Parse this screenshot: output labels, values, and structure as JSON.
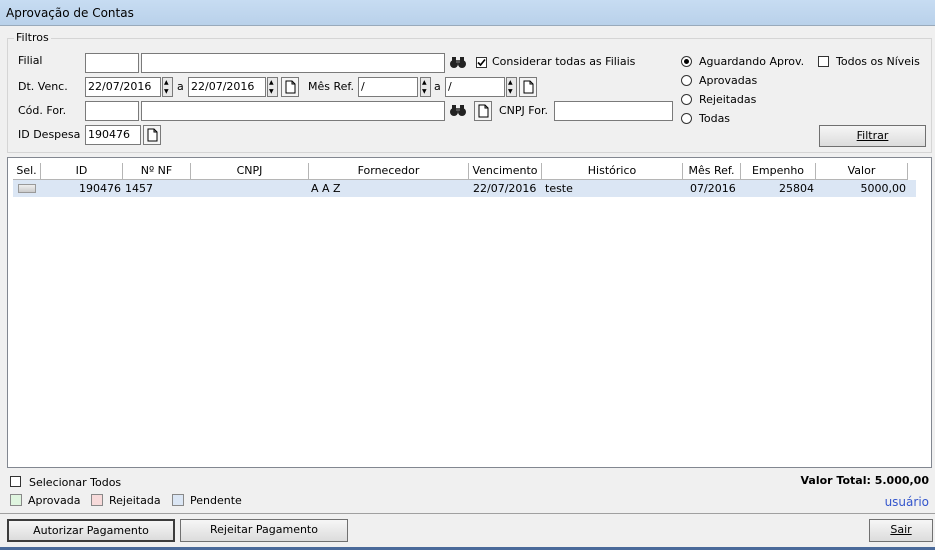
{
  "window": {
    "title": "Aprovação de Contas"
  },
  "filters": {
    "legend": "Filtros",
    "filial_label": "Filial",
    "filial_code": "",
    "filial_name": "",
    "considerar_label": "Considerar todas as Filiais",
    "dtvenc_label": "Dt. Venc.",
    "dt_from": "22/07/2016",
    "a_label": "a",
    "dt_to": "22/07/2016",
    "mesref_label": "Mês Ref.",
    "mesref_from": " /",
    "mesref_to": " /",
    "codfor_label": "Cód. For.",
    "codfor_code": "",
    "codfor_name": "",
    "cnpj_label": "CNPJ For.",
    "cnpj_value": "",
    "iddespesa_label": "ID Despesa",
    "iddespesa_value": "190476",
    "status_options": [
      "Aguardando Aprov.",
      "Aprovadas",
      "Rejeitadas",
      "Todas"
    ],
    "status_selected": "Aguardando Aprov.",
    "todos_niveis_label": "Todos os Níveis",
    "filtrar_label": "Filtrar"
  },
  "table": {
    "columns": [
      "Sel.",
      "ID",
      "Nº NF",
      "CNPJ",
      "Fornecedor",
      "Vencimento",
      "Histórico",
      "Mês Ref.",
      "Empenho",
      "Valor"
    ],
    "rows": [
      {
        "id": "190476",
        "nf": "1457",
        "cnpj": "",
        "fornecedor": "A A Z",
        "vencimento": "22/07/2016",
        "historico": "teste",
        "mesref": "07/2016",
        "empenho": "25804",
        "valor": "5000,00"
      }
    ]
  },
  "footer": {
    "selecionar_todos": "Selecionar Todos",
    "legend_aprovada": "Aprovada",
    "legend_rejeitada": "Rejeitada",
    "legend_pendente": "Pendente",
    "valor_total": "Valor Total: 5.000,00",
    "usuario": "usuário",
    "autorizar": "Autorizar Pagamento",
    "rejeitar": "Rejeitar Pagamento",
    "sair": "Sair"
  },
  "colors": {
    "aprovada": "#dff5df",
    "rejeitada": "#f7dada",
    "pendente": "#dbe6f4",
    "usuario": "#3355cc"
  }
}
